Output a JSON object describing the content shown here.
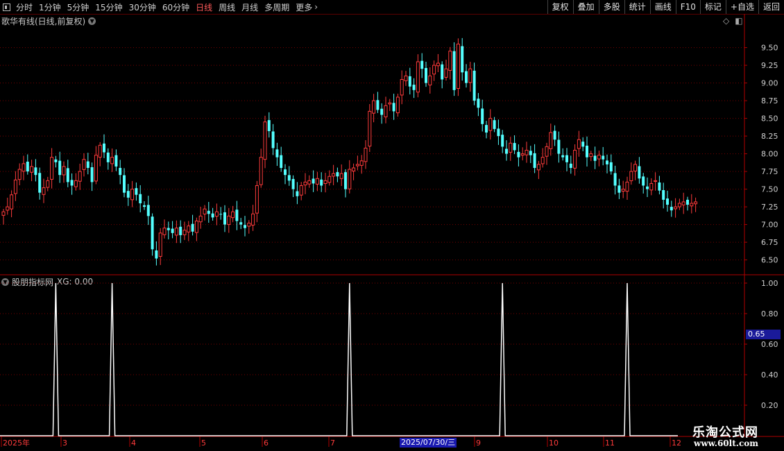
{
  "toolbar": {
    "periods": [
      "分时",
      "1分钟",
      "5分钟",
      "15分钟",
      "30分钟",
      "60分钟",
      "日线",
      "周线",
      "月线",
      "多周期",
      "更多"
    ],
    "active_period": "日线",
    "right_buttons": [
      "复权",
      "叠加",
      "多股",
      "统计",
      "画线",
      "F10",
      "标记",
      "+自选",
      "返回"
    ]
  },
  "main_chart": {
    "title": "歌华有线(日线,前复权)",
    "y_ticks": [
      "9.50",
      "9.25",
      "9.00",
      "8.75",
      "8.50",
      "8.25",
      "8.00",
      "7.75",
      "7.50",
      "7.25",
      "7.00",
      "6.75",
      "6.50"
    ]
  },
  "indicator": {
    "title": "股朋指标网",
    "value_text": "XG: 0.00",
    "y_ticks": [
      "1.00",
      "0.80",
      "0.60",
      "0.40",
      "0.20"
    ],
    "current_badge": "0.65"
  },
  "x_axis": {
    "labels": [
      "2025年",
      "3",
      "4",
      "5",
      "6",
      "7",
      "9",
      "10",
      "11",
      "12"
    ],
    "cursor_date": "2025/07/30/三"
  },
  "watermark": {
    "name": "乐淘公式网",
    "url": "www.60lt.com"
  },
  "colors": {
    "up": "#ff3b3b",
    "down": "#54ffff",
    "grid": "#7a0000",
    "signal": "#ffffff"
  },
  "chart_data": {
    "type": "candlestick",
    "ylim": [
      6.3,
      9.8
    ],
    "indicator_ylim": [
      0,
      1.05
    ],
    "closes": [
      7.18,
      7.25,
      7.42,
      7.63,
      7.78,
      7.86,
      7.75,
      7.82,
      7.7,
      7.45,
      7.52,
      7.62,
      7.95,
      7.88,
      7.7,
      7.82,
      7.6,
      7.55,
      7.62,
      7.75,
      7.92,
      7.8,
      7.6,
      7.98,
      8.12,
      8.02,
      7.88,
      7.95,
      7.82,
      7.7,
      7.45,
      7.38,
      7.5,
      7.42,
      7.3,
      7.25,
      7.12,
      6.65,
      6.52,
      6.88,
      6.95,
      6.92,
      6.88,
      6.95,
      6.85,
      6.92,
      6.98,
      6.9,
      7.05,
      7.12,
      7.22,
      7.15,
      7.1,
      7.18,
      7.15,
      7.0,
      7.12,
      7.18,
      7.05,
      7.0,
      6.95,
      7.02,
      7.15,
      7.55,
      7.95,
      8.45,
      8.32,
      8.08,
      7.95,
      7.8,
      7.7,
      7.62,
      7.5,
      7.4,
      7.55,
      7.6,
      7.62,
      7.58,
      7.65,
      7.55,
      7.62,
      7.68,
      7.72,
      7.68,
      7.72,
      7.5,
      7.78,
      7.8,
      7.85,
      7.9,
      8.08,
      8.6,
      8.75,
      8.62,
      8.55,
      8.68,
      8.72,
      8.6,
      8.8,
      9.05,
      9.1,
      8.95,
      8.9,
      9.3,
      9.2,
      9.0,
      9.1,
      9.25,
      9.28,
      9.05,
      9.2,
      9.45,
      8.9,
      9.55,
      9.15,
      9.0,
      9.2,
      8.75,
      8.65,
      8.42,
      8.3,
      8.5,
      8.35,
      8.25,
      8.1,
      8.0,
      8.15,
      8.05,
      7.95,
      8.0,
      8.05,
      7.98,
      7.8,
      7.85,
      7.95,
      8.1,
      8.3,
      8.2,
      8.0,
      7.95,
      7.88,
      7.8,
      8.05,
      8.2,
      8.1,
      7.95,
      8.0,
      7.9,
      7.98,
      7.92,
      7.85,
      7.75,
      7.55,
      7.45,
      7.5,
      7.6,
      7.75,
      7.85,
      7.65,
      7.55,
      7.5,
      7.58,
      7.62,
      7.48,
      7.35,
      7.28,
      7.2,
      7.25,
      7.3,
      7.32,
      7.28,
      7.3,
      7.32
    ],
    "signal_bars": [
      13,
      27,
      86,
      124,
      155
    ]
  }
}
